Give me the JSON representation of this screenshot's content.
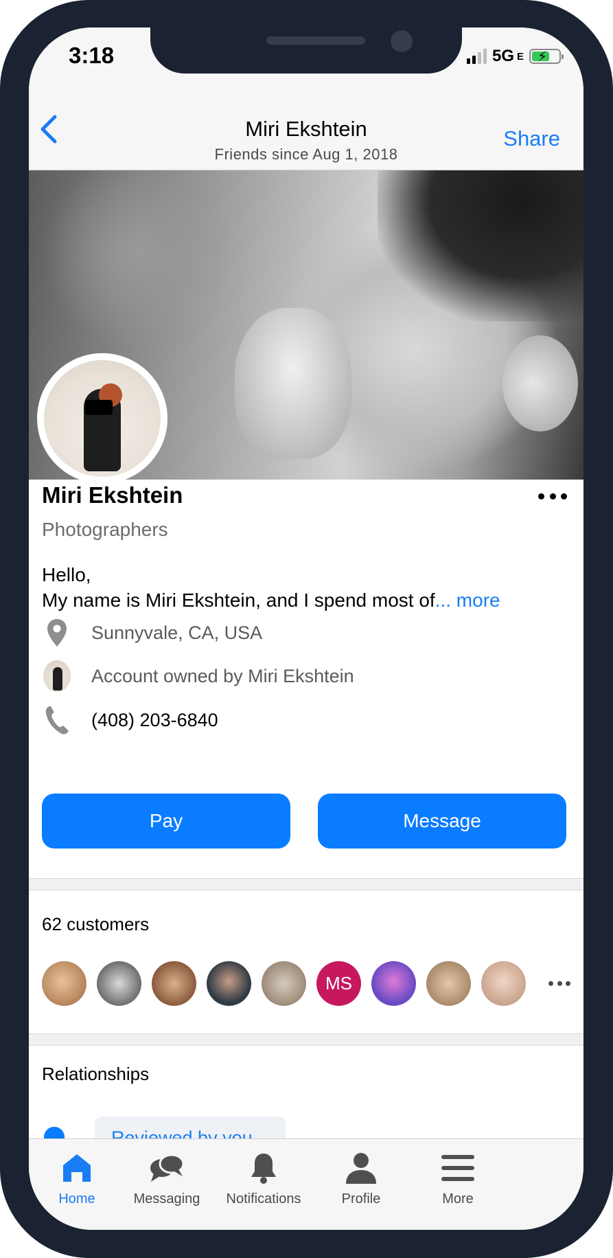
{
  "status_bar": {
    "time": "3:18",
    "network": "5G",
    "network_suffix": "E"
  },
  "header": {
    "title": "Miri Ekshtein",
    "subtitle": "Friends since Aug 1, 2018",
    "share_label": "Share"
  },
  "profile": {
    "name": "Miri Ekshtein",
    "category": "Photographers",
    "bio_line1": "Hello,",
    "bio_line2": "My name is Miri Ekshtein,  and I spend most of",
    "bio_more": "... more"
  },
  "info": {
    "location": "Sunnyvale, CA, USA",
    "owner": "Account owned by Miri Ekshtein",
    "phone": "(408) 203-6840"
  },
  "actions": {
    "pay_label": "Pay",
    "message_label": "Message"
  },
  "customers": {
    "title": "62 customers",
    "avatars": [
      {
        "initials": "",
        "color": "#b5835a"
      },
      {
        "initials": "",
        "color": "#6e6e6e"
      },
      {
        "initials": "",
        "color": "#8a5a3c"
      },
      {
        "initials": "",
        "color": "#2f3a44"
      },
      {
        "initials": "",
        "color": "#9c8b78"
      },
      {
        "initials": "MS",
        "color": "#c7185e"
      },
      {
        "initials": "",
        "color": "#6a4bc4"
      },
      {
        "initials": "",
        "color": "#a98a6a"
      },
      {
        "initials": "",
        "color": "#c9a38c"
      }
    ]
  },
  "relationships": {
    "title": "Relationships",
    "chip_label": "Reviewed by you"
  },
  "tabs": [
    {
      "label": "Home",
      "icon": "home-icon"
    },
    {
      "label": "Messaging",
      "icon": "messaging-icon"
    },
    {
      "label": "Notifications",
      "icon": "bell-icon"
    },
    {
      "label": "Profile",
      "icon": "profile-icon"
    },
    {
      "label": "More",
      "icon": "menu-icon"
    }
  ],
  "colors": {
    "accent": "#0a7cff",
    "link": "#1a7cf5",
    "frame": "#1b2232"
  }
}
